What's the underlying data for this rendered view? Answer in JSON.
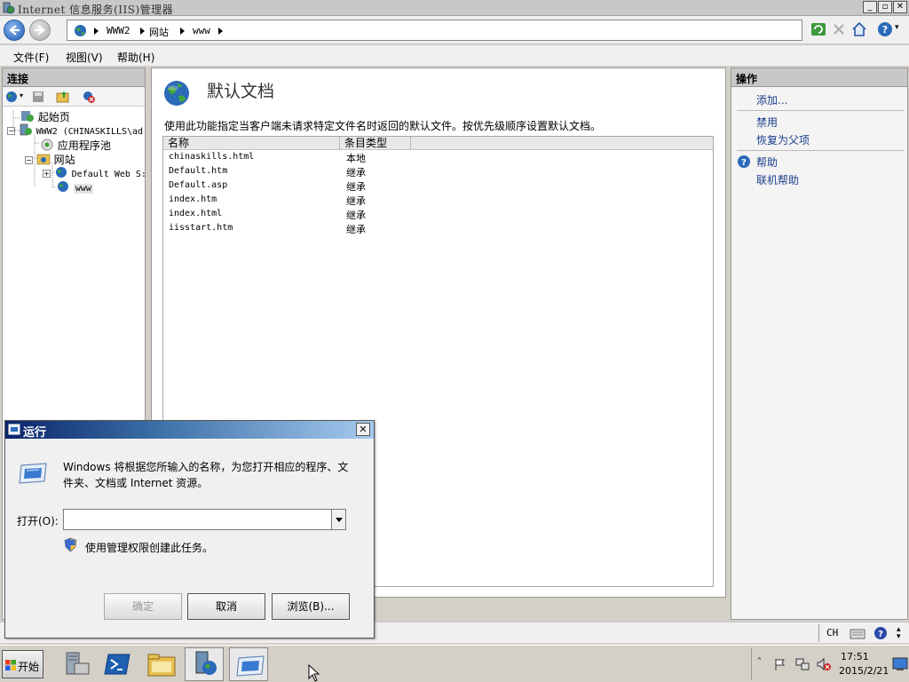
{
  "window": {
    "title": "Internet 信息服务(IIS)管理器"
  },
  "address": {
    "crumbs": [
      "WWW2",
      "网站",
      "www"
    ]
  },
  "menu": {
    "items": [
      "文件(F)",
      "视图(V)",
      "帮助(H)"
    ]
  },
  "connections": {
    "header": "连接",
    "tree": {
      "start_page": "起始页",
      "server": "WWW2 (CHINASKILLS\\ad",
      "app_pools": "应用程序池",
      "sites": "网站",
      "default_site": "Default Web S:",
      "www": "www"
    }
  },
  "content": {
    "title": "默认文档",
    "description": "使用此功能指定当客户端未请求特定文件名时返回的默认文件。按优先级顺序设置默认文档。",
    "columns": [
      "名称",
      "条目类型"
    ],
    "rows": [
      {
        "name": "chinaskills.html",
        "type": "本地"
      },
      {
        "name": "Default.htm",
        "type": "继承"
      },
      {
        "name": "Default.asp",
        "type": "继承"
      },
      {
        "name": "index.htm",
        "type": "继承"
      },
      {
        "name": "index.html",
        "type": "继承"
      },
      {
        "name": "iisstart.htm",
        "type": "继承"
      }
    ]
  },
  "actions": {
    "header": "操作",
    "add": "添加...",
    "disable": "禁用",
    "revert": "恢复为父项",
    "help": "帮助",
    "online_help": "联机帮助"
  },
  "status": {
    "ime": "CH"
  },
  "run_dialog": {
    "title": "运行",
    "message": "Windows 将根据您所输入的名称，为您打开相应的程序、文件夹、文档或 Internet 资源。",
    "open_label": "打开(O):",
    "input_value": "",
    "admin_note": "使用管理权限创建此任务。",
    "ok": "确定",
    "cancel": "取消",
    "browse": "浏览(B)..."
  },
  "taskbar": {
    "start_label": "开始",
    "time": "17:51",
    "date": "2015/2/21"
  },
  "colors": {
    "dialog_title_start": "#0a246a",
    "dialog_title_end": "#a6caf0",
    "link": "#1a3e8c"
  }
}
